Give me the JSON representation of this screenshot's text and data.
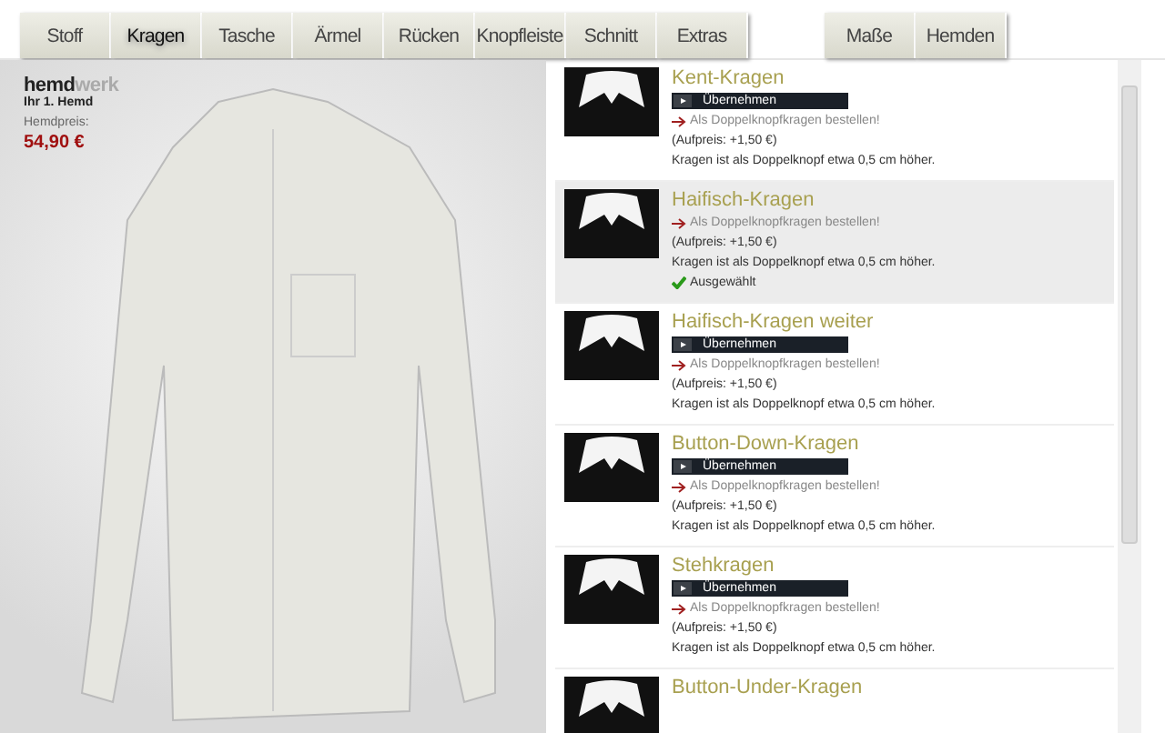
{
  "tabs": [
    {
      "label": "Stoff",
      "selected": false
    },
    {
      "label": "Kragen",
      "selected": true
    },
    {
      "label": "Tasche",
      "selected": false
    },
    {
      "label": "Ärmel",
      "selected": false
    },
    {
      "label": "Rücken",
      "selected": false
    },
    {
      "label": "Knopfleiste",
      "selected": false
    },
    {
      "label": "Schnitt",
      "selected": false
    },
    {
      "label": "Extras",
      "selected": false
    }
  ],
  "side_tabs": [
    {
      "label": "Maße",
      "selected": false
    },
    {
      "label": "Hemden",
      "selected": false
    }
  ],
  "brand": {
    "name_bold": "hemd",
    "name_light": "werk",
    "tagline": "Ihr 1. Hemd",
    "price_label": "Hemdpreis:",
    "price": "54,90 €"
  },
  "options": [
    {
      "name": "Kent-Kragen",
      "button": "Übernehmen",
      "link": "Als Doppelknopfkragen bestellen!",
      "surcharge": "(Aufpreis: +1,50 €)",
      "note": "Kragen ist als Doppelknopf etwa 0,5 cm höher.",
      "selected": false
    },
    {
      "name": "Haifisch-Kragen",
      "link": "Als Doppelknopfkragen bestellen!",
      "surcharge": "(Aufpreis: +1,50 €)",
      "note": "Kragen ist als Doppelknopf etwa 0,5 cm höher.",
      "status": "Ausgewählt",
      "selected": true
    },
    {
      "name": "Haifisch-Kragen weiter",
      "button": "Übernehmen",
      "link": "Als Doppelknopfkragen bestellen!",
      "surcharge": "(Aufpreis: +1,50 €)",
      "note": "Kragen ist als Doppelknopf etwa 0,5 cm höher.",
      "selected": false
    },
    {
      "name": "Button-Down-Kragen",
      "button": "Übernehmen",
      "link": "Als Doppelknopfkragen bestellen!",
      "surcharge": "(Aufpreis: +1,50 €)",
      "note": "Kragen ist als Doppelknopf etwa 0,5 cm höher.",
      "selected": false
    },
    {
      "name": "Stehkragen",
      "button": "Übernehmen",
      "link": "Als Doppelknopfkragen bestellen!",
      "surcharge": "(Aufpreis: +1,50 €)",
      "note": "Kragen ist als Doppelknopf etwa 0,5 cm höher.",
      "selected": false
    },
    {
      "name": "Button-Under-Kragen",
      "selected": false
    }
  ]
}
